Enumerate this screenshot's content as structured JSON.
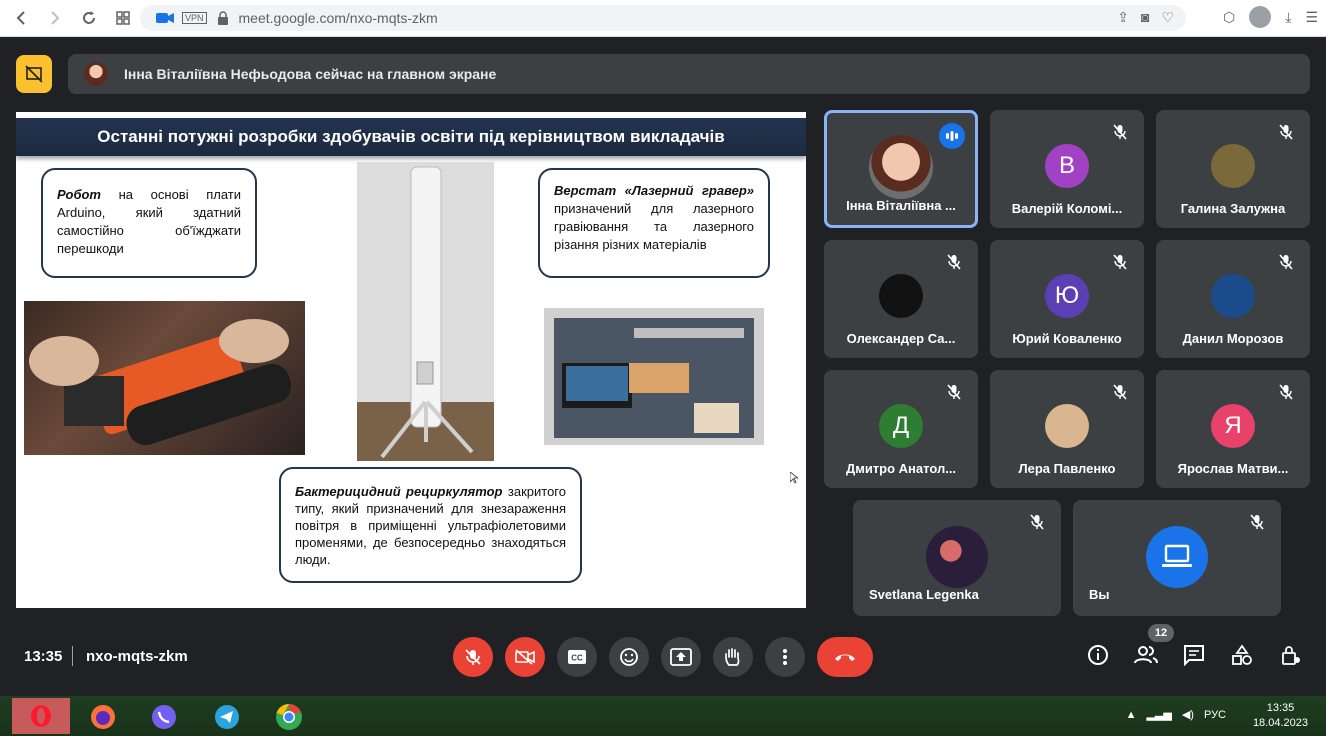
{
  "browser": {
    "url": "meet.google.com/nxo-mqts-zkm",
    "vpn_label": "VPN"
  },
  "banner": {
    "text": "Інна Віталіївна Нефьодова сейчас на главном экране"
  },
  "slide": {
    "title": "Останні потужні розробки здобувачів освіти під керівництвом викладачів",
    "robot": {
      "bold": "Робот",
      "text": " на основі плати Arduino, який здатний самостійно об'їжджати перешкоди"
    },
    "laser": {
      "bold": "Верстат «Лазерний гравер»",
      "text": " призначений для лазерного гравіювання та лазерного різання різних матеріалів"
    },
    "recirc": {
      "bold": "Бактерицидний рециркулятор",
      "text": " закритого типу, який призначений для знезараження повітря в приміщенні ультрафіолетовими променями, де безпосередньо знаходяться люди."
    }
  },
  "participants": [
    {
      "name": "Інна Віталіївна ...",
      "initial": "",
      "avatar_color": "#5f6368",
      "speaking": true
    },
    {
      "name": "Валерій Коломі...",
      "initial": "В",
      "avatar_color": "#a142c4",
      "speaking": false
    },
    {
      "name": "Галина Залужна",
      "initial": "",
      "avatar_color": "#7a6a3a",
      "speaking": false
    },
    {
      "name": "Олександер Са...",
      "initial": "",
      "avatar_color": "#111111",
      "speaking": false
    },
    {
      "name": "Юрий Коваленко",
      "initial": "Ю",
      "avatar_color": "#5a3fb5",
      "speaking": false
    },
    {
      "name": "Данил Морозов",
      "initial": "",
      "avatar_color": "#1b4b8a",
      "speaking": false
    },
    {
      "name": "Дмитро Анатол...",
      "initial": "Д",
      "avatar_color": "#2e7d32",
      "speaking": false
    },
    {
      "name": "Лера Павленко",
      "initial": "",
      "avatar_color": "#d9b68f",
      "speaking": false
    },
    {
      "name": "Ярослав Матви...",
      "initial": "Я",
      "avatar_color": "#e8416a",
      "speaking": false
    },
    {
      "name": "Svetlana Legenka",
      "initial": "",
      "avatar_color": "#3a2a4a",
      "speaking": false
    },
    {
      "name": "Вы",
      "initial": "",
      "avatar_color": "#1a73e8",
      "speaking": false
    }
  ],
  "controls": {
    "time": "13:35",
    "meeting_code": "nxo-mqts-zkm",
    "participants_count": "12"
  },
  "taskbar": {
    "lang": "РУС",
    "time": "13:35",
    "date": "18.04.2023"
  }
}
